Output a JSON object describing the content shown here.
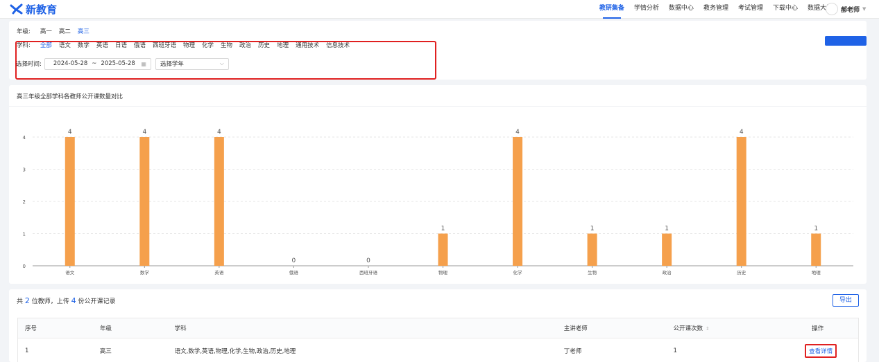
{
  "brand": {
    "name": "新教育",
    "color": "#1f62e6"
  },
  "nav": {
    "items": [
      {
        "label": "教研集备",
        "active": true
      },
      {
        "label": "学情分析"
      },
      {
        "label": "数据中心"
      },
      {
        "label": "教务管理"
      },
      {
        "label": "考试管理"
      },
      {
        "label": "下载中心"
      },
      {
        "label": "数据大屏"
      }
    ],
    "user": "郝老师"
  },
  "filters": {
    "grade_label": "年级:",
    "grades": [
      "高一",
      "高二",
      "高三"
    ],
    "grade_active": "高三",
    "subject_label": "学科:",
    "subjects": [
      "全部",
      "语文",
      "数学",
      "英语",
      "日语",
      "俄语",
      "西班牙语",
      "物理",
      "化学",
      "生物",
      "政治",
      "历史",
      "地理",
      "通用技术",
      "信息技术"
    ],
    "subject_active": "全部",
    "time_label": "选择时间:",
    "date_start": "2024-05-28",
    "date_sep": "~",
    "date_end": "2025-05-28",
    "year_placeholder": "选择学年"
  },
  "chart_data": {
    "type": "bar",
    "title": "高三年级全部学科各教师公开课数量对比",
    "categories": [
      "语文",
      "数学",
      "英语",
      "俄语",
      "西班牙语",
      "物理",
      "化学",
      "生物",
      "政治",
      "历史",
      "地理"
    ],
    "values": [
      4,
      4,
      4,
      0,
      0,
      1,
      4,
      1,
      1,
      4,
      1
    ],
    "ylim": [
      0,
      4
    ],
    "yticks": [
      0,
      1,
      2,
      3,
      4
    ],
    "grid": true,
    "bar_color": "#f5a04c",
    "data_labels": true
  },
  "summary": {
    "prefix": "共",
    "teachers": "2",
    "mid1": "位教师，上传",
    "records": "4",
    "suffix": "份公开课记录"
  },
  "export_label": "导出",
  "table": {
    "headers": [
      "序号",
      "年级",
      "学科",
      "主讲老师",
      "公开课次数",
      "操作"
    ],
    "rows": [
      {
        "index": "1",
        "grade": "高三",
        "subjects": "语文,数学,英语,物理,化学,生物,政治,历史,地理",
        "teacher": "丁老师",
        "count": "1",
        "action": "查看详情"
      }
    ]
  }
}
